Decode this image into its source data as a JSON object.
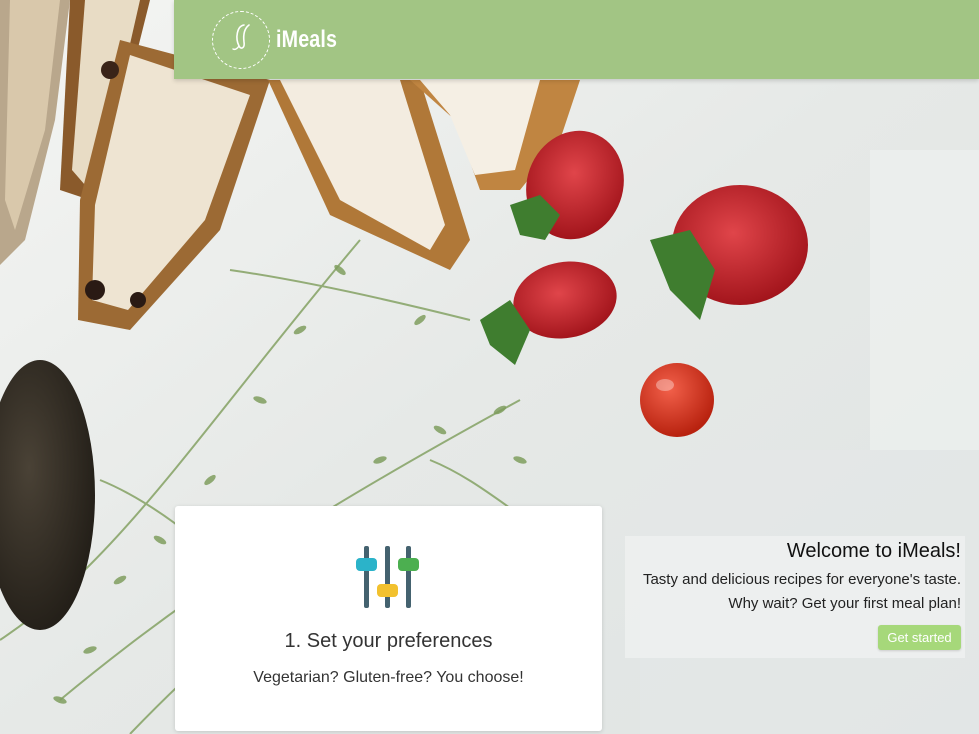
{
  "header": {
    "brand": "iMeals",
    "logo_icon": "leaf-script-logo"
  },
  "feature_card": {
    "icon": "sliders-icon",
    "title": "1. Set your preferences",
    "text": "Vegetarian? Gluten-free? You choose!",
    "icon_colors": [
      "#2bb3c9",
      "#f2c12e",
      "#4caf50"
    ]
  },
  "welcome": {
    "title": "Welcome to iMeals!",
    "line1": "Tasty and delicious recipes for everyone's taste.",
    "line2": "Why wait? Get your first meal plan!",
    "button_label": "Get started"
  },
  "colors": {
    "header_bg": "#a2c584",
    "button_bg": "#a6d87a"
  }
}
